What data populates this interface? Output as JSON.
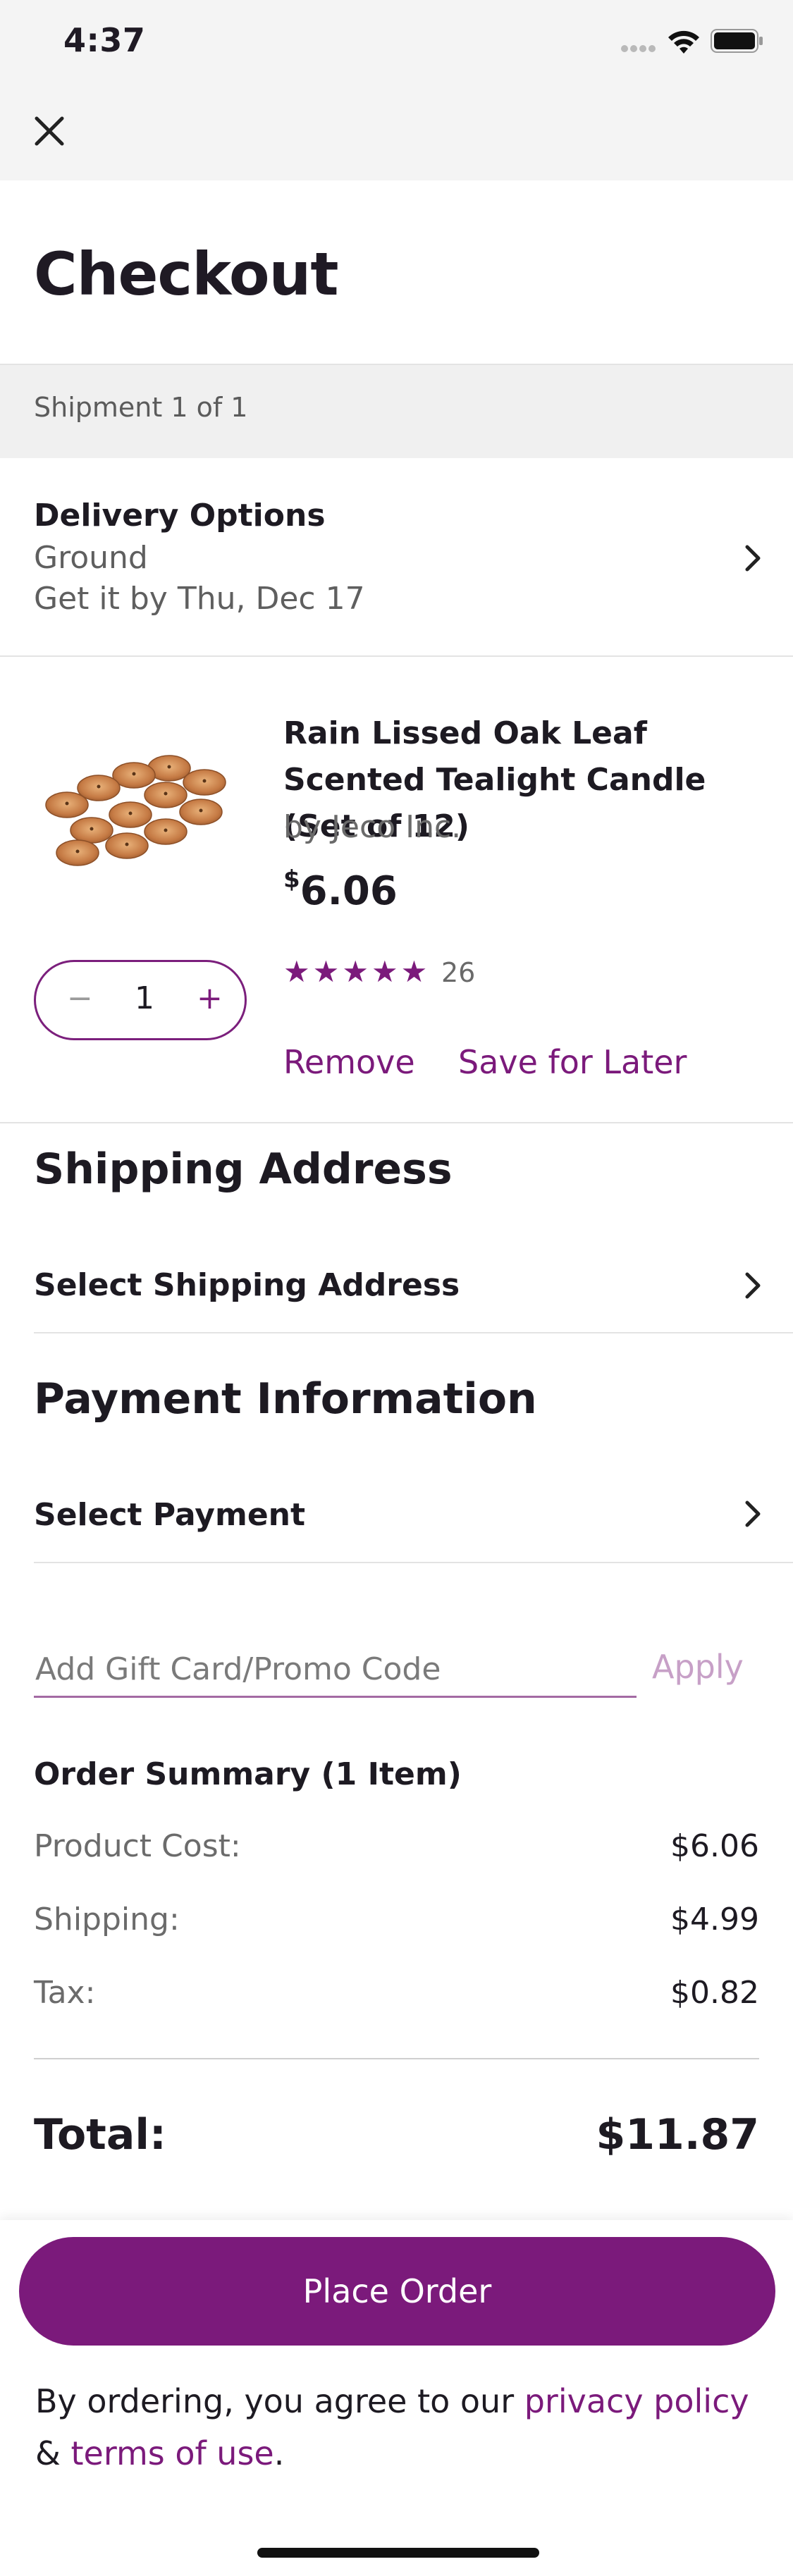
{
  "status_bar": {
    "time": "4:37"
  },
  "header": {
    "title": "Checkout"
  },
  "shipment": {
    "label": "Shipment 1 of 1"
  },
  "delivery": {
    "heading": "Delivery Options",
    "method": "Ground",
    "eta": "Get it by Thu, Dec 17"
  },
  "product": {
    "title": "Rain Lissed Oak Leaf Scented Tealight Candle (Set of 12)",
    "vendor": "by Jeco Inc.",
    "price_symbol": "$",
    "price_amount": "6.06",
    "rating_stars": 5,
    "review_count": "26",
    "quantity": "1",
    "minus": "−",
    "plus": "+",
    "remove_label": "Remove",
    "save_label": "Save for Later"
  },
  "shipping_address": {
    "heading": "Shipping Address",
    "select_label": "Select Shipping Address"
  },
  "payment": {
    "heading": "Payment Information",
    "select_label": "Select Payment"
  },
  "promo": {
    "placeholder": "Add Gift Card/Promo Code",
    "apply_label": "Apply"
  },
  "summary": {
    "heading": "Order Summary (1 Item)",
    "product_cost_label": "Product Cost:",
    "product_cost_value": "$6.06",
    "shipping_label": "Shipping:",
    "shipping_value": "$4.99",
    "tax_label": "Tax:",
    "tax_value": "$0.82",
    "total_label": "Total:",
    "total_value": "$11.87"
  },
  "footer": {
    "place_order_label": "Place Order",
    "legal_prefix": "By ordering, you agree to our ",
    "privacy_link": "privacy policy",
    "legal_mid": " & ",
    "terms_link": "terms of use",
    "legal_suffix": "."
  },
  "colors": {
    "accent": "#7b1a7b",
    "apply_disabled": "#c7a0c7",
    "band_gray": "#f0f0f0"
  },
  "icons": {
    "close": "close-icon",
    "chevron": "chevron-right-icon",
    "wifi": "wifi-icon",
    "battery": "battery-icon",
    "signal": "signal-icon",
    "star": "star-icon"
  }
}
